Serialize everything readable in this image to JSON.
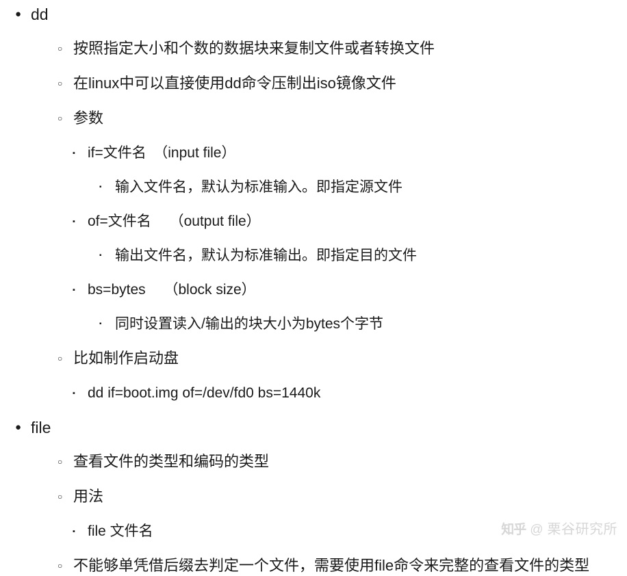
{
  "document": {
    "background_color": "#ffffff",
    "text_color": "#1a1a1a",
    "outline": [
      {
        "level": 1,
        "bullet": "disc-bullet",
        "marker": "●",
        "text": "dd"
      },
      {
        "level": 2,
        "bullet": "circle-bullet",
        "marker": "○",
        "text": "按照指定大小和个数的数据块来复制文件或者转换文件"
      },
      {
        "level": 2,
        "bullet": "circle-bullet",
        "marker": "○",
        "text": "在linux中可以直接使用dd命令压制出iso镜像文件"
      },
      {
        "level": 2,
        "bullet": "circle-bullet",
        "marker": "○",
        "text": "参数"
      },
      {
        "level": 3,
        "bullet": "square-bullet",
        "marker": "▪",
        "text": "if=文件名　（input file）"
      },
      {
        "level": 4,
        "bullet": "square-bullet",
        "marker": "▪",
        "text": "输入文件名，默认为标准输入。即指定源文件"
      },
      {
        "level": 3,
        "bullet": "square-bullet",
        "marker": "▪",
        "text": "of=文件名　 （output file）"
      },
      {
        "level": 4,
        "bullet": "square-bullet",
        "marker": "▪",
        "text": "输出文件名，默认为标准输出。即指定目的文件"
      },
      {
        "level": 3,
        "bullet": "square-bullet",
        "marker": "▪",
        "text": "bs=bytes　 （block size）"
      },
      {
        "level": 4,
        "bullet": "square-bullet",
        "marker": "▪",
        "text": "同时设置读入/输出的块大小为bytes个字节"
      },
      {
        "level": 2,
        "bullet": "circle-bullet",
        "marker": "○",
        "text": "比如制作启动盘"
      },
      {
        "level": 3,
        "bullet": "square-bullet",
        "marker": "▪",
        "text": "dd if=boot.img of=/dev/fd0 bs=1440k"
      },
      {
        "level": 1,
        "bullet": "disc-bullet",
        "marker": "●",
        "text": "file"
      },
      {
        "level": 2,
        "bullet": "circle-bullet",
        "marker": "○",
        "text": "查看文件的类型和编码的类型"
      },
      {
        "level": 2,
        "bullet": "circle-bullet",
        "marker": "○",
        "text": "用法"
      },
      {
        "level": 3,
        "bullet": "square-bullet",
        "marker": "▪",
        "text": "file 文件名"
      },
      {
        "level": 2,
        "bullet": "circle-bullet",
        "marker": "○",
        "text": "不能够单凭借后缀去判定一个文件，需要使用file命令来完整的查看文件的类型"
      }
    ]
  },
  "watermark": {
    "logo": "知乎",
    "at": "@",
    "name": "栗谷研究所",
    "color": "#7a7a7a"
  }
}
